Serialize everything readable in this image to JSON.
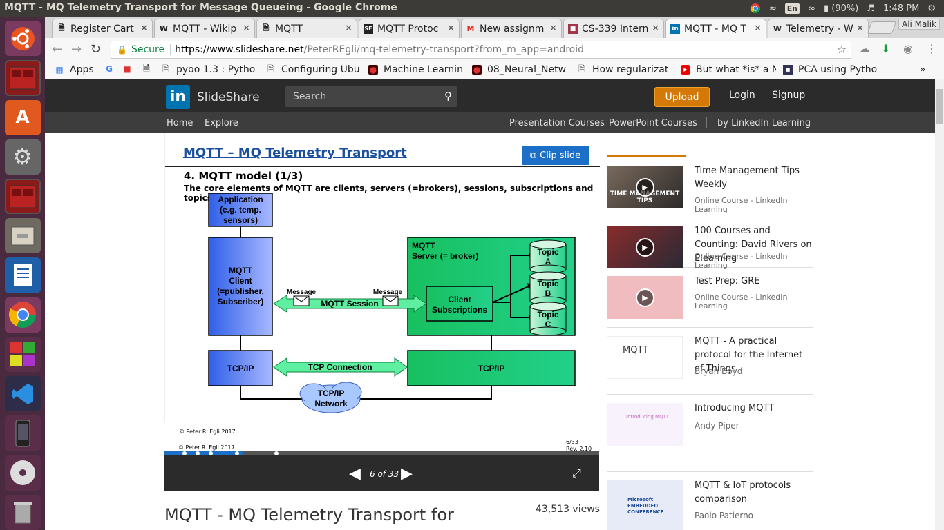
{
  "window": {
    "title": "MQTT - MQ Telemetry Transport for Message Queueing - Google Chrome"
  },
  "tray": {
    "keyboard": "En",
    "battery": "(90%)",
    "clock": "1:48 PM"
  },
  "launcher": {
    "icons": [
      "ubuntu-icon",
      "terminal-icon",
      "software-center-icon",
      "settings-icon",
      "terminal-icon-2",
      "files-icon",
      "writer-icon",
      "chrome-icon",
      "workspace-icon",
      "vscode-icon",
      "phone-icon",
      "dvd-icon",
      "trash-icon"
    ]
  },
  "tabs": [
    {
      "label": "Register Cart",
      "icon": "doc"
    },
    {
      "label": "MQTT - Wikip",
      "icon": "W"
    },
    {
      "label": "MQTT",
      "icon": "doc"
    },
    {
      "label": "MQTT Protoc",
      "icon": "SF"
    },
    {
      "label": "New assignm",
      "icon": "M"
    },
    {
      "label": "CS-339 Intern",
      "icon": "cs"
    },
    {
      "label": "MQTT - MQ T",
      "icon": "in"
    },
    {
      "label": "Telemetry - W",
      "icon": "W"
    }
  ],
  "profile": "Ali Malik",
  "address": {
    "secure_label": "Secure",
    "host": "https://www.slideshare.net",
    "path": "/PeterREgli/mq-telemetry-transport?from_m_app=android"
  },
  "bookmarks": [
    {
      "label": "Apps"
    },
    {
      "label": "G"
    },
    {
      "label": ""
    },
    {
      "label": ""
    },
    {
      "label": "pyoo 1.3 : Pytho"
    },
    {
      "label": "Configuring Ubu"
    },
    {
      "label": "Machine Learnin"
    },
    {
      "label": "08_Neural_Netw"
    },
    {
      "label": "How regularizat"
    },
    {
      "label": "But what *is* a N"
    },
    {
      "label": "PCA using Pytho"
    }
  ],
  "slideshare": {
    "brand": "SlideShare",
    "search_placeholder": "Search",
    "upload": "Upload",
    "login": "Login",
    "signup": "Signup",
    "nav_left": [
      "Home",
      "Explore"
    ],
    "nav_right": [
      "Presentation Courses",
      "PowerPoint Courses",
      "by LinkedIn Learning"
    ]
  },
  "slide": {
    "header": "MQTT – MQ Telemetry Transport",
    "clip_label": "Clip slide",
    "title": "4. MQTT model (1/3)",
    "subtitle": "The core elements of MQTT are clients, servers (=brokers), sessions, subscriptions and topics.",
    "app_box": "Application\n(e.g. temp.\nsensors)",
    "client_box": "MQTT\nClient\n(=publisher,\nSubscriber)",
    "server_box": "MQTT\nServer (= broker)",
    "subs_box": "Client\nSubscriptions",
    "topics": [
      "Topic\nA",
      "Topic\nB",
      "Topic\nC"
    ],
    "message_left": "Message",
    "message_right": "Message",
    "session": "MQTT Session",
    "tcp_left": "TCP/IP",
    "tcp_conn": "TCP Connection",
    "tcp_right": "TCP/IP",
    "network": "TCP/IP\nNetwork",
    "footer_left": "© Peter R. Egli 2017",
    "footer_right": "6/33\nRev. 2.10",
    "progress": 0.18
  },
  "player": {
    "page_label": "6 of 33"
  },
  "deck": {
    "title": "MQTT - MQ Telemetry Transport for Message Queueing",
    "views": "43,513 views"
  },
  "related": [
    {
      "title": "Time Management Tips Weekly",
      "meta": "Online Course - LinkedIn Learning",
      "thumb_text": "TIME MANAGEMENT TIPS",
      "video": true
    },
    {
      "title": "100 Courses and Counting: David Rivers on Elearning",
      "meta": "Online Course - LinkedIn Learning",
      "thumb_text": "",
      "video": true
    },
    {
      "title": "Test Prep: GRE",
      "meta": "Online Course - LinkedIn Learning",
      "thumb_text": "",
      "video": true
    },
    {
      "title": "MQTT - A practical protocol for the Internet of Things",
      "meta": "Bryan Boyd",
      "thumb_text": "MQTT",
      "video": false
    },
    {
      "title": "Introducing MQTT",
      "meta": "Andy Piper",
      "thumb_text": "Introducing MQTT",
      "video": false
    },
    {
      "title": "MQTT & IoT protocols comparison",
      "meta": "Paolo Patierno",
      "thumb_text": "Microsoft EMBEDDED CONFERENCE",
      "video": false
    }
  ]
}
